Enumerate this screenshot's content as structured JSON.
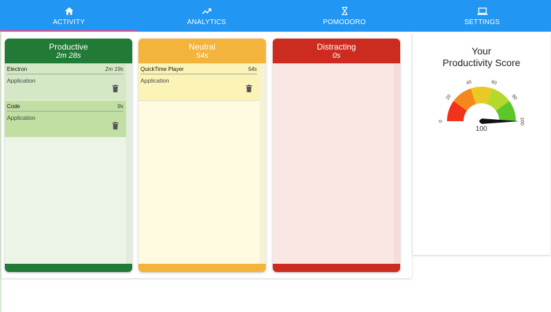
{
  "nav": {
    "tabs": [
      {
        "label": "ACTIVITY",
        "icon": "home-icon",
        "active": true
      },
      {
        "label": "ANALYTICS",
        "icon": "trending-up-icon",
        "active": false
      },
      {
        "label": "POMODORO",
        "icon": "hourglass-icon",
        "active": false
      },
      {
        "label": "SETTINGS",
        "icon": "laptop-icon",
        "active": false
      }
    ]
  },
  "columns": {
    "productive": {
      "title": "Productive",
      "duration": "2m 28s",
      "color": "#217b36",
      "cards": [
        {
          "name": "Electron",
          "duration": "2m 19s",
          "type": "Application"
        },
        {
          "name": "Code",
          "duration": "9s",
          "type": "Application"
        }
      ]
    },
    "neutral": {
      "title": "Neutral",
      "duration": "54s",
      "color": "#f4b33b",
      "cards": [
        {
          "name": "QuickTime Player",
          "duration": "54s",
          "type": "Application"
        }
      ]
    },
    "distracting": {
      "title": "Distracting",
      "duration": "0s",
      "color": "#cc2c1f",
      "cards": []
    }
  },
  "score": {
    "title_line1": "Your",
    "title_line2": "Productivity Score",
    "value": 100,
    "value_label": "100",
    "ticks": [
      "0",
      "20",
      "40",
      "60",
      "80",
      "100"
    ],
    "segment_colors": [
      "#f2331b",
      "#f5871e",
      "#e9c923",
      "#b4d92a",
      "#5cc72a"
    ]
  }
}
